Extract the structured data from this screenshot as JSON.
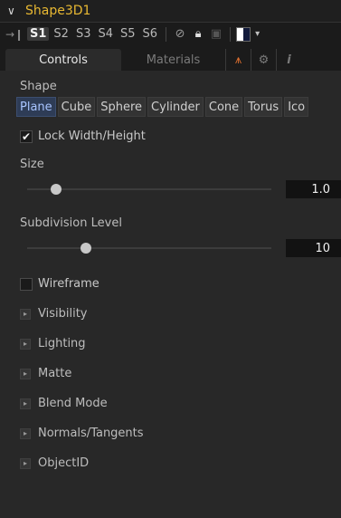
{
  "header": {
    "title": "Shape3D1"
  },
  "toolbar": {
    "slots": [
      "S1",
      "S2",
      "S3",
      "S4",
      "S5",
      "S6"
    ],
    "active_slot": "S1"
  },
  "tabs": {
    "controls": "Controls",
    "materials": "Materials"
  },
  "shape": {
    "label": "Shape",
    "options": [
      "Plane",
      "Cube",
      "Sphere",
      "Cylinder",
      "Cone",
      "Torus",
      "Ico"
    ],
    "selected": "Plane"
  },
  "lock": {
    "label": "Lock Width/Height",
    "checked": true
  },
  "size": {
    "label": "Size",
    "value": "1.0",
    "fraction": 0.12
  },
  "subdivision": {
    "label": "Subdivision Level",
    "value": "10",
    "fraction": 0.24
  },
  "wireframe": {
    "label": "Wireframe",
    "checked": false
  },
  "sections": [
    "Visibility",
    "Lighting",
    "Matte",
    "Blend Mode",
    "Normals/Tangents",
    "ObjectID"
  ],
  "colors": {
    "title": "#e8b832",
    "accent": "#2e3c56"
  }
}
